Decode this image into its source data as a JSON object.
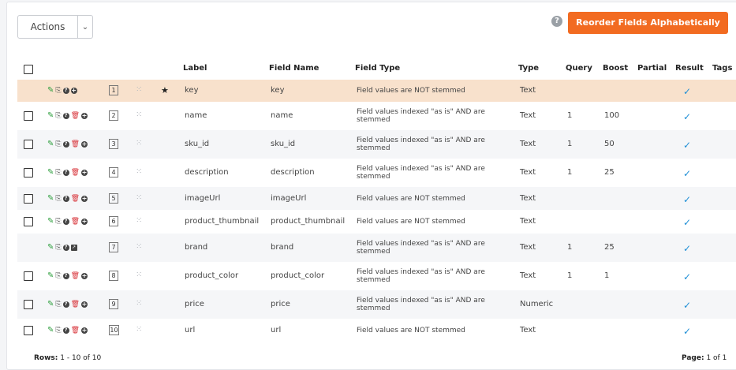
{
  "toolbar": {
    "actions_label": "Actions",
    "help_icon": "?",
    "reorder_label": "Reorder Fields Alphabetically",
    "accent_color": "#f26b21"
  },
  "table": {
    "headers": {
      "label": "Label",
      "field_name": "Field Name",
      "field_type": "Field Type",
      "type": "Type",
      "query": "Query",
      "boost": "Boost",
      "partial": "Partial",
      "result": "Result",
      "tags": "Tags"
    },
    "rows": [
      {
        "order": "1",
        "label": "key",
        "field_name": "key",
        "field_type": "Field values are NOT stemmed",
        "type": "Text",
        "query": "",
        "boost": "",
        "partial": "",
        "result": true,
        "checkbox": false,
        "star": true,
        "selected": true,
        "icons": [
          "edit-icon",
          "copy-icon",
          "help-icon",
          "add-icon"
        ]
      },
      {
        "order": "2",
        "label": "name",
        "field_name": "name",
        "field_type": "Field values indexed \"as is\" AND are stemmed",
        "type": "Text",
        "query": "1",
        "boost": "100",
        "partial": "",
        "result": true,
        "checkbox": true,
        "icons": [
          "edit-icon",
          "copy-icon",
          "help-icon",
          "delete-icon",
          "add-icon"
        ]
      },
      {
        "order": "3",
        "label": "sku_id",
        "field_name": "sku_id",
        "field_type": "Field values indexed \"as is\" AND are stemmed",
        "type": "Text",
        "query": "1",
        "boost": "50",
        "partial": "",
        "result": true,
        "checkbox": true,
        "icons": [
          "edit-icon",
          "copy-icon",
          "help-icon",
          "delete-icon",
          "add-icon"
        ]
      },
      {
        "order": "4",
        "label": "description",
        "field_name": "description",
        "field_type": "Field values indexed \"as is\" AND are stemmed",
        "type": "Text",
        "query": "1",
        "boost": "25",
        "partial": "",
        "result": true,
        "checkbox": true,
        "icons": [
          "edit-icon",
          "copy-icon",
          "help-icon",
          "delete-icon",
          "add-icon"
        ]
      },
      {
        "order": "5",
        "label": "imageUrl",
        "field_name": "imageUrl",
        "field_type": "Field values are NOT stemmed",
        "type": "Text",
        "query": "",
        "boost": "",
        "partial": "",
        "result": true,
        "checkbox": true,
        "icons": [
          "edit-icon",
          "copy-icon",
          "help-icon",
          "delete-icon",
          "add-icon"
        ]
      },
      {
        "order": "6",
        "label": "product_thumbnail",
        "field_name": "product_thumbnail",
        "field_type": "Field values are NOT stemmed",
        "type": "Text",
        "query": "",
        "boost": "",
        "partial": "",
        "result": true,
        "checkbox": true,
        "icons": [
          "edit-icon",
          "copy-icon",
          "help-icon",
          "delete-icon",
          "add-icon"
        ]
      },
      {
        "order": "7",
        "label": "brand",
        "field_name": "brand",
        "field_type": "Field values indexed \"as is\" AND are stemmed",
        "type": "Text",
        "query": "1",
        "boost": "25",
        "partial": "",
        "result": true,
        "checkbox": false,
        "icons": [
          "edit-icon",
          "copy-icon",
          "help-icon",
          "external-icon"
        ]
      },
      {
        "order": "8",
        "label": "product_color",
        "field_name": "product_color",
        "field_type": "Field values indexed \"as is\" AND are stemmed",
        "type": "Text",
        "query": "1",
        "boost": "1",
        "partial": "",
        "result": true,
        "checkbox": true,
        "icons": [
          "edit-icon",
          "copy-icon",
          "help-icon",
          "delete-icon",
          "add-icon"
        ]
      },
      {
        "order": "9",
        "label": "price",
        "field_name": "price",
        "field_type": "Field values indexed \"as is\" AND are stemmed",
        "type": "Numeric",
        "query": "",
        "boost": "",
        "partial": "",
        "result": true,
        "checkbox": true,
        "icons": [
          "edit-icon",
          "copy-icon",
          "help-icon",
          "delete-icon",
          "add-icon"
        ]
      },
      {
        "order": "10",
        "label": "url",
        "field_name": "url",
        "field_type": "Field values are NOT stemmed",
        "type": "Text",
        "query": "",
        "boost": "",
        "partial": "",
        "result": true,
        "checkbox": true,
        "icons": [
          "edit-icon",
          "copy-icon",
          "help-icon",
          "delete-icon",
          "add-icon"
        ]
      }
    ]
  },
  "footer": {
    "rows_label": "Rows:",
    "rows_value": "1 - 10 of 10",
    "page_label": "Page:",
    "page_value": "1 of 1"
  }
}
